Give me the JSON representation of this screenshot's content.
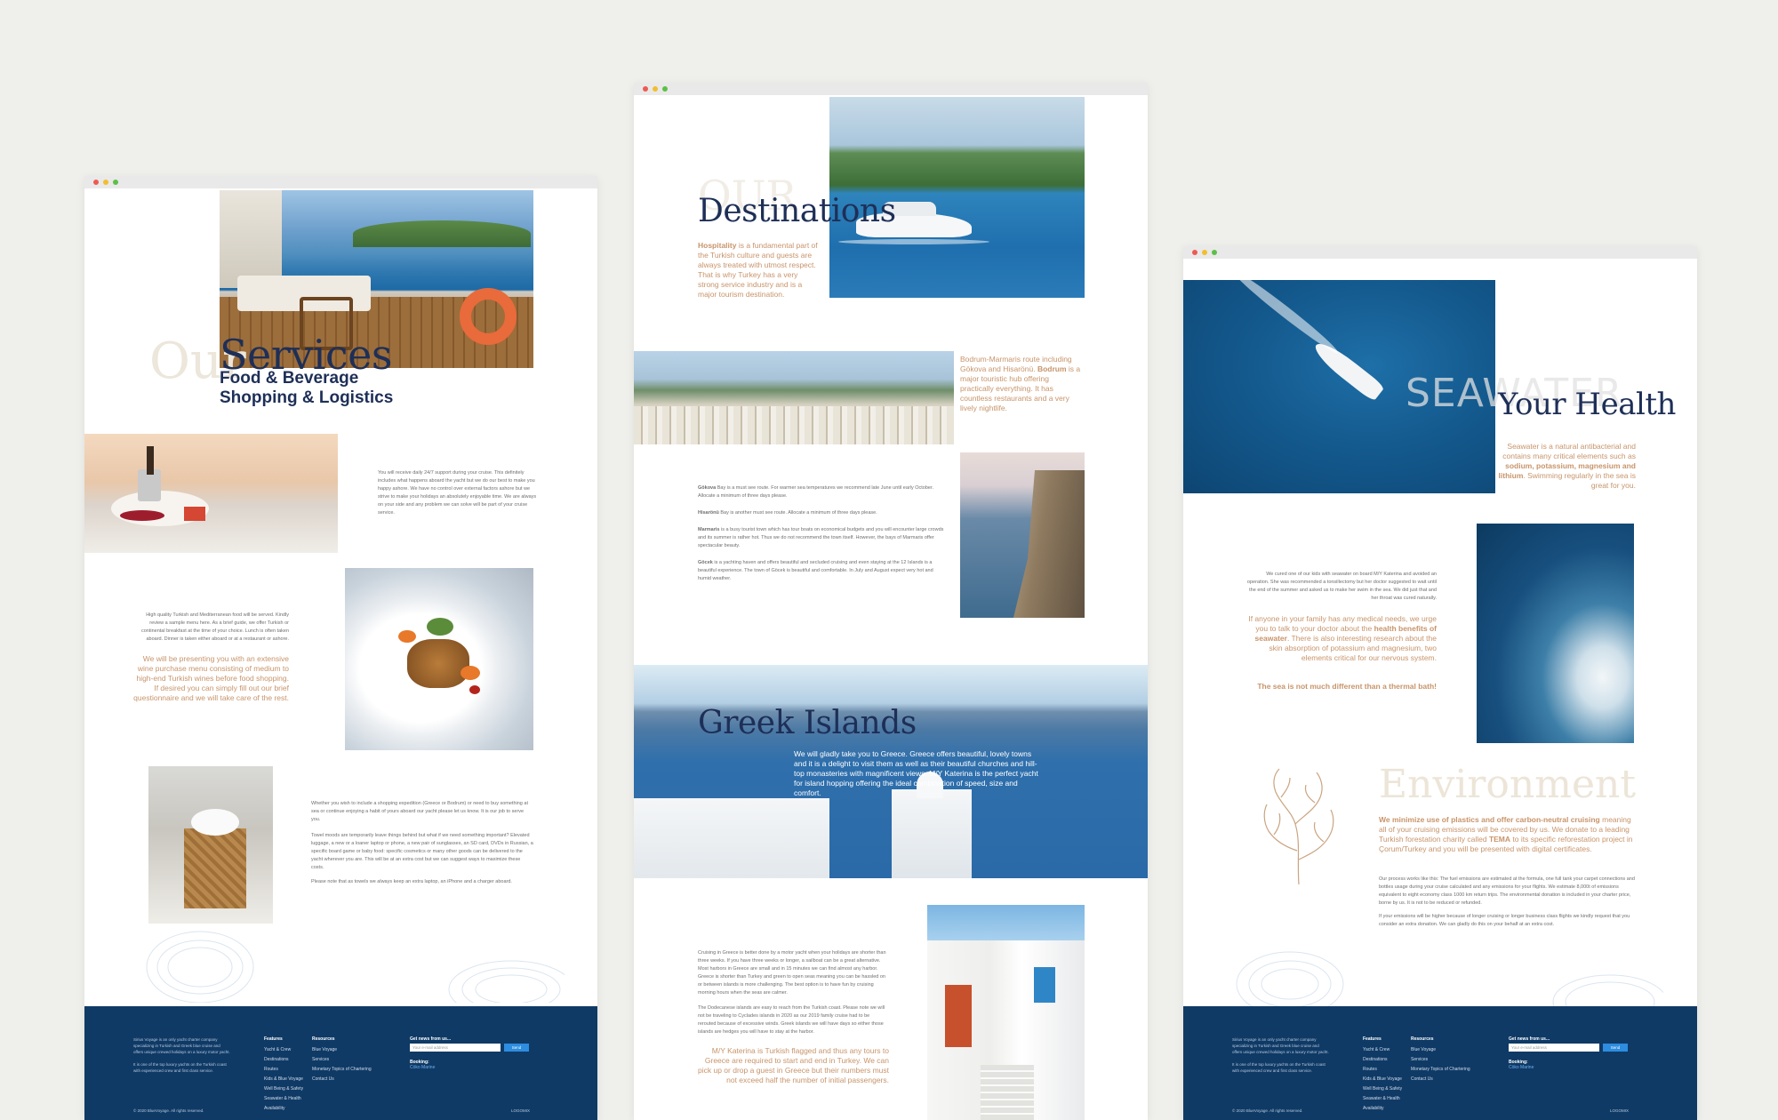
{
  "colors": {
    "navy": "#1e2f57",
    "footer": "#0f3a66",
    "accent_orange": "#c8946a",
    "button_blue": "#2d8de0",
    "background": "#efefeb"
  },
  "services": {
    "ghost_word": "Our",
    "title": "Services",
    "subtitle_1": "Food & Beverage",
    "subtitle_2": "Shopping & Logistics",
    "support_text": "You will receive daily 24/7 support during your cruise. This definitely includes what happens aboard the yacht but we do our best to make you happy ashore. We have no control over external factors ashore but we strive to make your holidays an absolutely enjoyable time. We are always on your side and any problem we can solve will be part of your cruise service.",
    "food_text": "High quality Turkish and Mediterranean food will be served. Kindly review a sample menu here. As a brief guide, we offer Turkish or continental breakfast at the time of your choice. Lunch is often taken aboard. Dinner is taken either aboard or at a restaurant or ashore.",
    "wine_text": "We will be presenting you with an extensive wine purchase menu consisting of medium to high-end Turkish wines before food shopping. If desired you can simply fill out our brief questionnaire and we will take care of the rest.",
    "shopping_text_1": "Whether you wish to include a shopping expedition (Greece or Bodrum) or need to buy something at sea or continue enjoying a habit of yours aboard our yacht please let us know. It is our job to serve you.",
    "shopping_text_2": "Towel moods are temporarily leave things behind but what if we need something important? Elevated luggage, a new or a loaner laptop or phone, a new pair of sunglasses, an SD card, DVDs in Russian, a specific board game or baby food: specific cosmetics or many other goods can be delivered to the yacht wherever you are. This will be at an extra cost but we can suggest ways to maximize these costs.",
    "shopping_text_3": "Please note that as towels we always keep an extra laptop, an iPhone and a charger aboard."
  },
  "destinations": {
    "ghost_word": "OUR",
    "title": "Destinations",
    "hospitality_bold": "Hospitality",
    "hospitality_text": " is a fundamental part of the Turkish culture and guests are always treated with utmost respect. That is why Turkey has a very strong service industry and is a major tourism destination.",
    "bodrum_text_1": "Bodrum-Marmaris route including Gökova and Hisarönü. ",
    "bodrum_bold": "Bodrum",
    "bodrum_text_2": " is a major touristic hub offering practically everything. It has countless restaurants and a very lively nightlife.",
    "gokova_label": "Gökova",
    "gokova_text": " Bay is a must see route. For warmer sea temperatures we recommend late June until early October. Allocate a minimum of three days please.",
    "hisaronu_label": "Hisarönü",
    "hisaronu_text": " Bay is another must see route. Allocate a minimum of three days please.",
    "marmaris_label": "Marmaris",
    "marmaris_text": " is a busy tourist town which has tour boats on economical budgets and you will encounter large crowds and its summer is rather hot. Thus we do not recommend the town itself. However, the bays of Marmaris offer spectacular beauty.",
    "gocek_label": "Göcek",
    "gocek_text": " is a yachting haven and offers beautiful and secluded cruising and even staying at the 12 Islands is a beautiful experience. The town of Göcek is beautiful and comfortable. In July and August expect very hot and humid weather.",
    "greek_title": "Greek Islands",
    "greek_text": "We will gladly take you to Greece. Greece offers beautiful, lovely towns and it is a delight to visit them as well as their beautiful churches and hill-top monasteries with magnificent views. M/Y Katerina is the perfect yacht for island hopping offering the ideal combination of speed, size and comfort.",
    "greece_text_1": "Cruising in Greece is better done by a motor yacht when your holidays are shorter than three weeks. If you have three weeks or longer, a sailboat can be a great alternative. Most harbors in Greece are small and in 15 minutes we can find almost any harbor. Greece is shorter than Turkey and green to open seas meaning you can be hassled on or between islands is more challenging. The best option is to have fun by cruising morning hours when the seas are calmer.",
    "greece_text_2": "The Dodecanese islands are easy to reach from the Turkish coast. Please note we will not be traveling to Cyclades islands in 2020 as our 2019 family cruise had to be rerouted because of excessive winds. Greek islands we will have days so either those islands are hedges you will have to stay at the harbor.",
    "katerina_text": "M/Y Katerina is Turkish flagged and thus any tours to Greece are required to start and end in Turkey. We can pick up or drop a guest in Greece but their numbers must not exceed half the number of initial passengers."
  },
  "health": {
    "ghost_word": "SEAWATER",
    "title": "Your Health",
    "intro_text_1": "Seawater is a natural antibacterial and contains many critical elements such as ",
    "intro_bold": "sodium, potassium, magnesium and lithium",
    "intro_text_2": ". Swimming regularly in the sea is great for you.",
    "doctor_text": "We cured one of our kids with seawater on board M/Y Katerina and avoided an operation. She was recommended a tonsillectomy but her doctor suggested to wait until the end of the summer and asked us to make her swim in the sea. We did just that and her throat was cured naturally.",
    "medical_text_1": "If anyone in your family has any medical needs, we urge you to talk to your doctor about the ",
    "medical_bold": "health benefits of seawater",
    "medical_text_2": ". There is also interesting research about the skin absorption of potassium and magnesium, two elements critical for our nervous system.",
    "thermal_text": "The sea is not much different than a thermal bath!",
    "env_title": "Environment",
    "env_bold": "We minimize use of plastics and offer carbon-neutral cruising",
    "env_text_1": " meaning all of your cruising emissions will be covered by us. We donate to a leading Turkish forestation charity called ",
    "env_tema": "TEMA",
    "env_text_2": " to its specific reforestation project in Çorum/Turkey and you will be presented with digital certificates.",
    "env_body_1": "Our process works like this: The fuel emissions are estimated at the formula, one full tank your carpet connections and bottles usage during your cruise calculated and any emissions for your flights. We estimate 8,000t of emissions equivalent to eight economy class 1000 km return trips. The environmental donation is included in your charter price, borne by us. It is not to be reduced or refunded.",
    "env_body_2": "If your emissions will be higher because of longer cruising or longer business class flights we kindly request that you consider an extra donation. We can gladly do this on your behalf at an extra cost."
  },
  "footer": {
    "about_1": "Sirius Voyage is an only yacht charter company specializing in Turkish and Greek blue cruise and offers unique crewed holidays on a luxury motor yacht.",
    "about_2": "It is one of the top luxury yachts on the Turkish coast with experienced crew and first class service.",
    "features_head": "Features",
    "features": [
      "Yacht & Crew",
      "Destinations",
      "Routes",
      "Kids & Blue Voyage",
      "Well Being & Safety",
      "Seawater & Health",
      "Availability"
    ],
    "resources_head": "Resources",
    "resources": [
      "Blue Voyage",
      "Services",
      "Monetary Topics of Chartering",
      "Contact Us"
    ],
    "news_head": "Get news from us...",
    "email_placeholder": "Your e-mail address",
    "send_label": "Send",
    "booking_head": "Booking:",
    "booking_link": "Cöko Marine",
    "copyright": "© 2020 BlueVoyage. All rights reserved.",
    "credit": "LOGOMIX"
  },
  "icons": [
    "coral-illustration-icon"
  ]
}
